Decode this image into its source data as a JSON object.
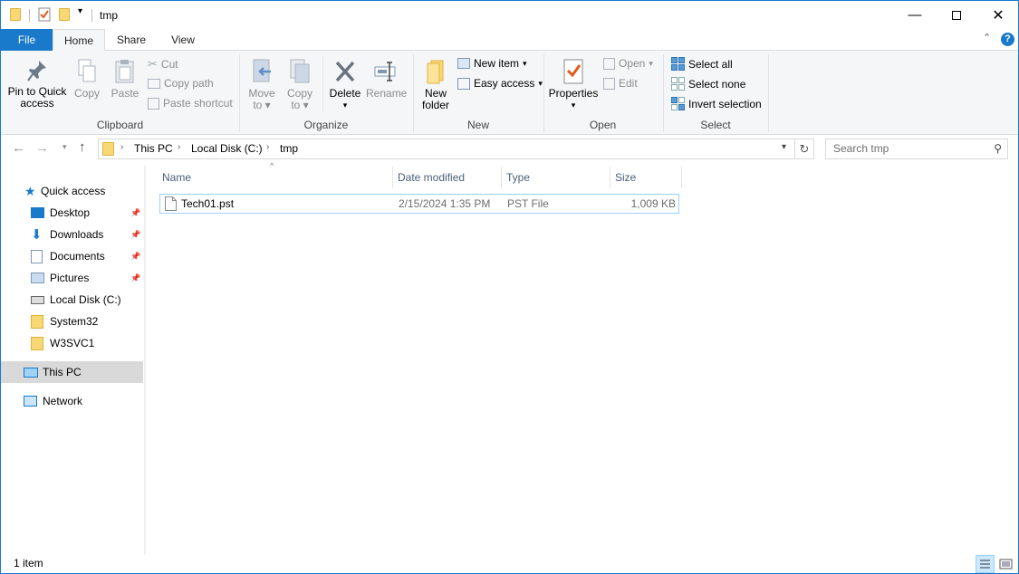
{
  "window": {
    "title": "tmp"
  },
  "ribbon_tabs": [
    "File",
    "Home",
    "Share",
    "View"
  ],
  "ribbon": {
    "clipboard": {
      "group_label": "Clipboard",
      "pin_line1": "Pin to Quick",
      "pin_line2": "access",
      "copy": "Copy",
      "paste": "Paste",
      "cut": "Cut",
      "copy_path": "Copy path",
      "paste_shortcut": "Paste shortcut"
    },
    "organize": {
      "group_label": "Organize",
      "move_line1": "Move",
      "move_line2": "to",
      "copy_line1": "Copy",
      "copy_line2": "to",
      "delete": "Delete",
      "rename": "Rename"
    },
    "new": {
      "group_label": "New",
      "folder_line1": "New",
      "folder_line2": "folder",
      "new_item": "New item",
      "easy_access": "Easy access"
    },
    "open": {
      "group_label": "Open",
      "properties": "Properties",
      "open": "Open",
      "edit": "Edit"
    },
    "select": {
      "group_label": "Select",
      "select_all": "Select all",
      "select_none": "Select none",
      "invert": "Invert selection"
    }
  },
  "address": {
    "crumbs": [
      "This PC",
      "Local Disk (C:)",
      "tmp"
    ]
  },
  "search": {
    "placeholder": "Search tmp"
  },
  "nav_pane": {
    "quick_access": "Quick access",
    "desktop": "Desktop",
    "downloads": "Downloads",
    "documents": "Documents",
    "pictures": "Pictures",
    "local_disk": "Local Disk (C:)",
    "system32": "System32",
    "w3svc1": "W3SVC1",
    "this_pc": "This PC",
    "network": "Network"
  },
  "columns": {
    "name": "Name",
    "date": "Date modified",
    "type": "Type",
    "size": "Size"
  },
  "files": [
    {
      "name": "Tech01.pst",
      "date": "2/15/2024 1:35 PM",
      "type": "PST File",
      "size": "1,009 KB"
    }
  ],
  "status": {
    "count": "1 item"
  },
  "colors": {
    "accent": "#1979ca",
    "selection": "#cce8ff",
    "folder": "#f8d775"
  }
}
